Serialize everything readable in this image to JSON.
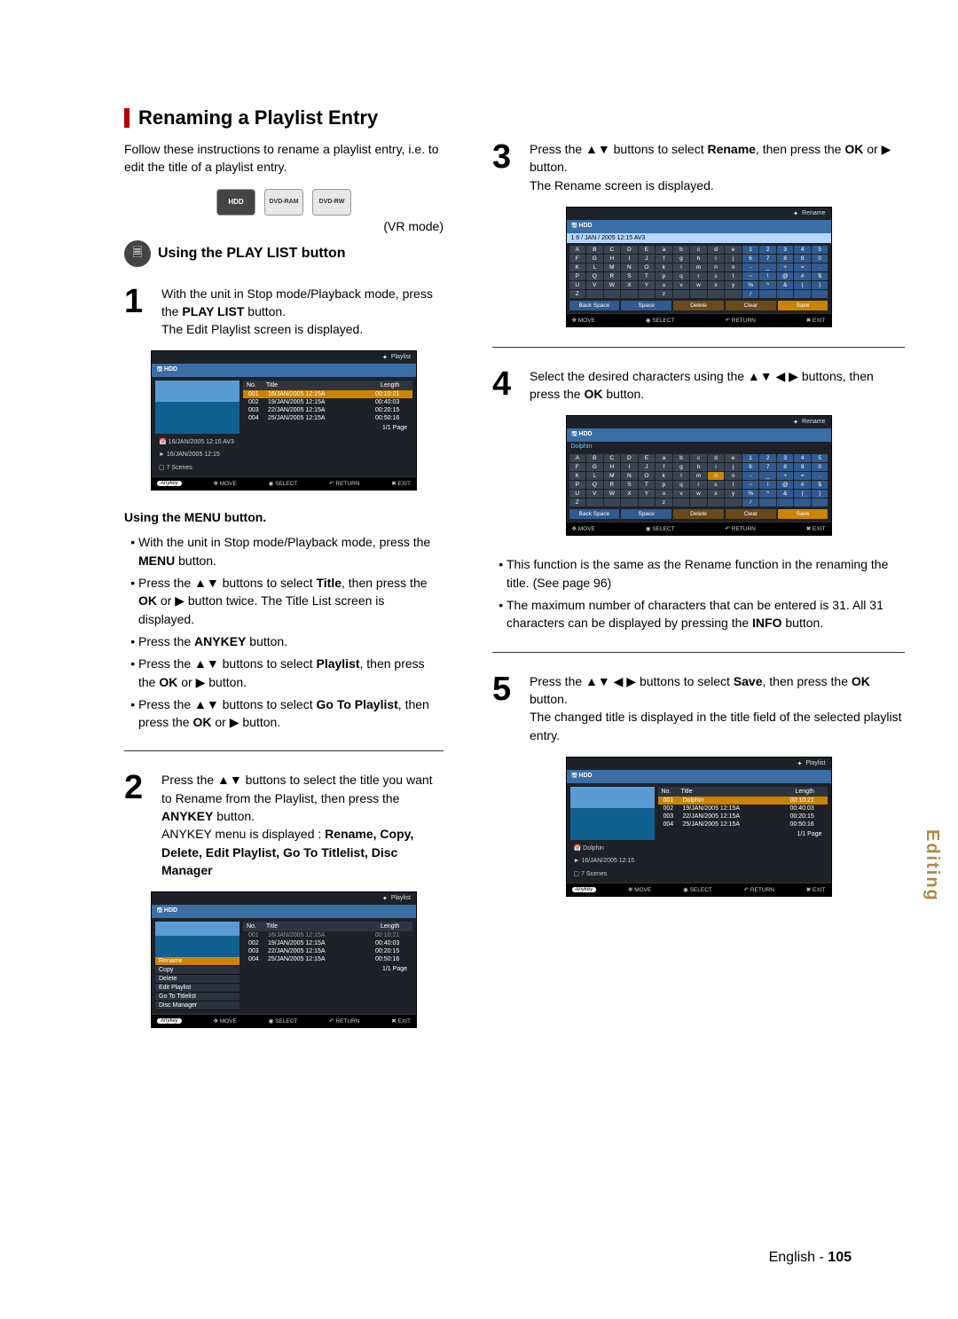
{
  "side_tab": "Editing",
  "page_footer_lang": "English",
  "page_footer_sep": " - ",
  "page_footer_num": "105",
  "heading": "Renaming a Playlist Entry",
  "intro": "Follow these instructions to rename a playlist entry, i.e. to edit the title of a playlist entry.",
  "disc_icons": {
    "hdd": "HDD",
    "ram": "DVD-RAM",
    "rw": "DVD-RW"
  },
  "vr_mode": "(VR mode)",
  "subhead": "Using the PLAY LIST button",
  "step1_line1_a": "With the unit in Stop mode/Playback mode, press the ",
  "step1_line1_b": "PLAY LIST",
  "step1_line1_c": " button.",
  "step1_line2": "The Edit Playlist screen is displayed.",
  "screen_playlist_title": "Playlist",
  "screen_hdd": "HDD",
  "screen_headers": {
    "no": "No.",
    "title": "Title",
    "length": "Length"
  },
  "playlist_rows": [
    {
      "no": "001",
      "title": "16/JAN/2005 12:15A",
      "len": "00:10:21"
    },
    {
      "no": "002",
      "title": "19/JAN/2005 12:15A",
      "len": "00:40:03"
    },
    {
      "no": "003",
      "title": "22/JAN/2005 12:15A",
      "len": "00:20:15"
    },
    {
      "no": "004",
      "title": "25/JAN/2005 12:15A",
      "len": "00:50:16"
    }
  ],
  "screen1_meta1": "16/JAN/2005 12:15 AV3",
  "screen1_meta2": "16/JAN/2005 12:15",
  "screen1_scenes": "7 Scenes",
  "screen_page": "1/1 Page",
  "footer_move": "MOVE",
  "footer_select": "SELECT",
  "footer_return": "RETURN",
  "footer_exit": "EXIT",
  "footer_anykey": "Anykey",
  "sub_using_menu": "Using the MENU button.",
  "menu_b1_a": "With the unit in Stop mode/Playback mode, press the ",
  "menu_b1_b": "MENU",
  "menu_b1_c": " button.",
  "menu_b2_a": "Press the ▲▼ buttons to select ",
  "menu_b2_b": "Title",
  "menu_b2_c": ", then press the ",
  "menu_b2_d": "OK",
  "menu_b2_e": " or ▶ button twice. The Title List screen is displayed.",
  "menu_b3_a": "Press the ",
  "menu_b3_b": "ANYKEY",
  "menu_b3_c": " button.",
  "menu_b4_a": "Press the ▲▼ buttons to select ",
  "menu_b4_b": "Playlist",
  "menu_b4_c": ", then press the ",
  "menu_b4_d": "OK",
  "menu_b4_e": " or ▶ button.",
  "menu_b5_a": "Press the ▲▼ buttons to select ",
  "menu_b5_b": "Go To Playlist",
  "menu_b5_c": ", then press the ",
  "menu_b5_d": "OK",
  "menu_b5_e": " or ▶ button.",
  "step2_a": "Press the ▲▼ buttons to select the title you want to Rename from the Playlist, then press the ",
  "step2_b": "ANYKEY",
  "step2_c": " button.",
  "step2_d": "ANYKEY menu is displayed : ",
  "step2_menu": "Rename, Copy, Delete, Edit Playlist, Go To Titlelist, Disc Manager",
  "anykey_items": [
    "Rename",
    "Copy",
    "Delete",
    "Edit Playlist",
    "Go To Titlelist",
    "Disc Manager"
  ],
  "step3_a": "Press the ▲▼ buttons to select ",
  "step3_b": "Rename",
  "step3_c": ", then press the ",
  "step3_d": "OK",
  "step3_e": " or ▶ button.",
  "step3_f": "The Rename screen is displayed.",
  "screen_rename_title": "Rename",
  "rename_bar_initial": "1 6 / JAN / 2005 12:15 AV3",
  "rename_bar_after": "Dolphin",
  "kb_upper": [
    "A",
    "B",
    "C",
    "D",
    "E",
    "F",
    "G",
    "H",
    "I",
    "J",
    "K",
    "L",
    "M",
    "N",
    "O",
    "P",
    "Q",
    "R",
    "S",
    "T",
    "U",
    "V",
    "W",
    "X",
    "Y",
    "Z",
    "",
    "",
    "",
    ""
  ],
  "kb_lower": [
    "a",
    "b",
    "c",
    "d",
    "e",
    "f",
    "g",
    "h",
    "i",
    "j",
    "k",
    "l",
    "m",
    "n",
    "o",
    "p",
    "q",
    "r",
    "s",
    "t",
    "u",
    "v",
    "w",
    "x",
    "y",
    "z",
    "",
    "",
    "",
    ""
  ],
  "kb_nums": [
    "1",
    "2",
    "3",
    "4",
    "5",
    "6",
    "7",
    "8",
    "9",
    "0",
    "-",
    "_",
    "+",
    "=",
    ".",
    "~",
    "!",
    "@",
    "#",
    "$",
    "%",
    "^",
    "&",
    "(",
    ")",
    "/",
    "",
    "",
    "",
    ""
  ],
  "wide_keys": {
    "back": "Back Space",
    "space": "Space",
    "delete": "Delete",
    "clear": "Clear",
    "save": "Save"
  },
  "step4_a": "Select the desired characters using the ▲▼ ◀ ▶ buttons, then press the ",
  "step4_b": "OK",
  "step4_c": " button.",
  "note1": "This function is the same as the Rename function in the renaming the title. (See page 96)",
  "note2_a": "The maximum number of characters that can be entered is 31. All 31 characters can be displayed by pressing the ",
  "note2_b": "INFO",
  "note2_c": " button.",
  "step5_a": "Press the ▲▼ ◀ ▶ buttons to select ",
  "step5_b": "Save",
  "step5_c": ", then press the ",
  "step5_d": "OK",
  "step5_e": " button.",
  "step5_f": "The changed title is displayed in the title field of the selected playlist entry.",
  "playlist_rows_after": [
    {
      "no": "001",
      "title": "Dolphin",
      "len": "00:10:21"
    },
    {
      "no": "002",
      "title": "19/JAN/2005 12:15A",
      "len": "00:40:03"
    },
    {
      "no": "003",
      "title": "22/JAN/2005 12:15A",
      "len": "00:20:15"
    },
    {
      "no": "004",
      "title": "25/JAN/2005 12:15A",
      "len": "00:50:16"
    }
  ],
  "screen5_meta1": "Dolphin",
  "screen5_meta2": "16/JAN/2005 12:15",
  "screen5_scenes": "7 Scenes"
}
